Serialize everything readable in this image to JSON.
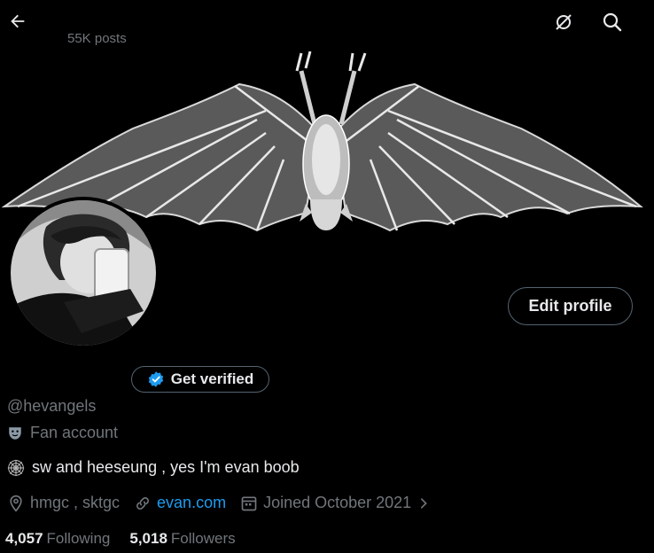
{
  "header": {
    "post_count": "55K posts",
    "icons": [
      "back-arrow-icon",
      "grok-icon",
      "search-icon"
    ]
  },
  "profile": {
    "edit_button": "Edit profile",
    "get_verified": "Get verified",
    "handle": "@hevangels",
    "category": "Fan account",
    "bio": "sw and heeseung , yes I'm evan boob",
    "location": "hmgc , sktgc",
    "website": "evan.com",
    "joined": "Joined October 2021",
    "following_count": "4,057",
    "following_label": "Following",
    "followers_count": "5,018",
    "followers_label": "Followers"
  },
  "colors": {
    "background": "#000000",
    "text_primary": "#e7e9ea",
    "text_secondary": "#71767b",
    "link": "#1d9bf0",
    "border": "#536471",
    "verified_badge": "#1d9bf0"
  }
}
